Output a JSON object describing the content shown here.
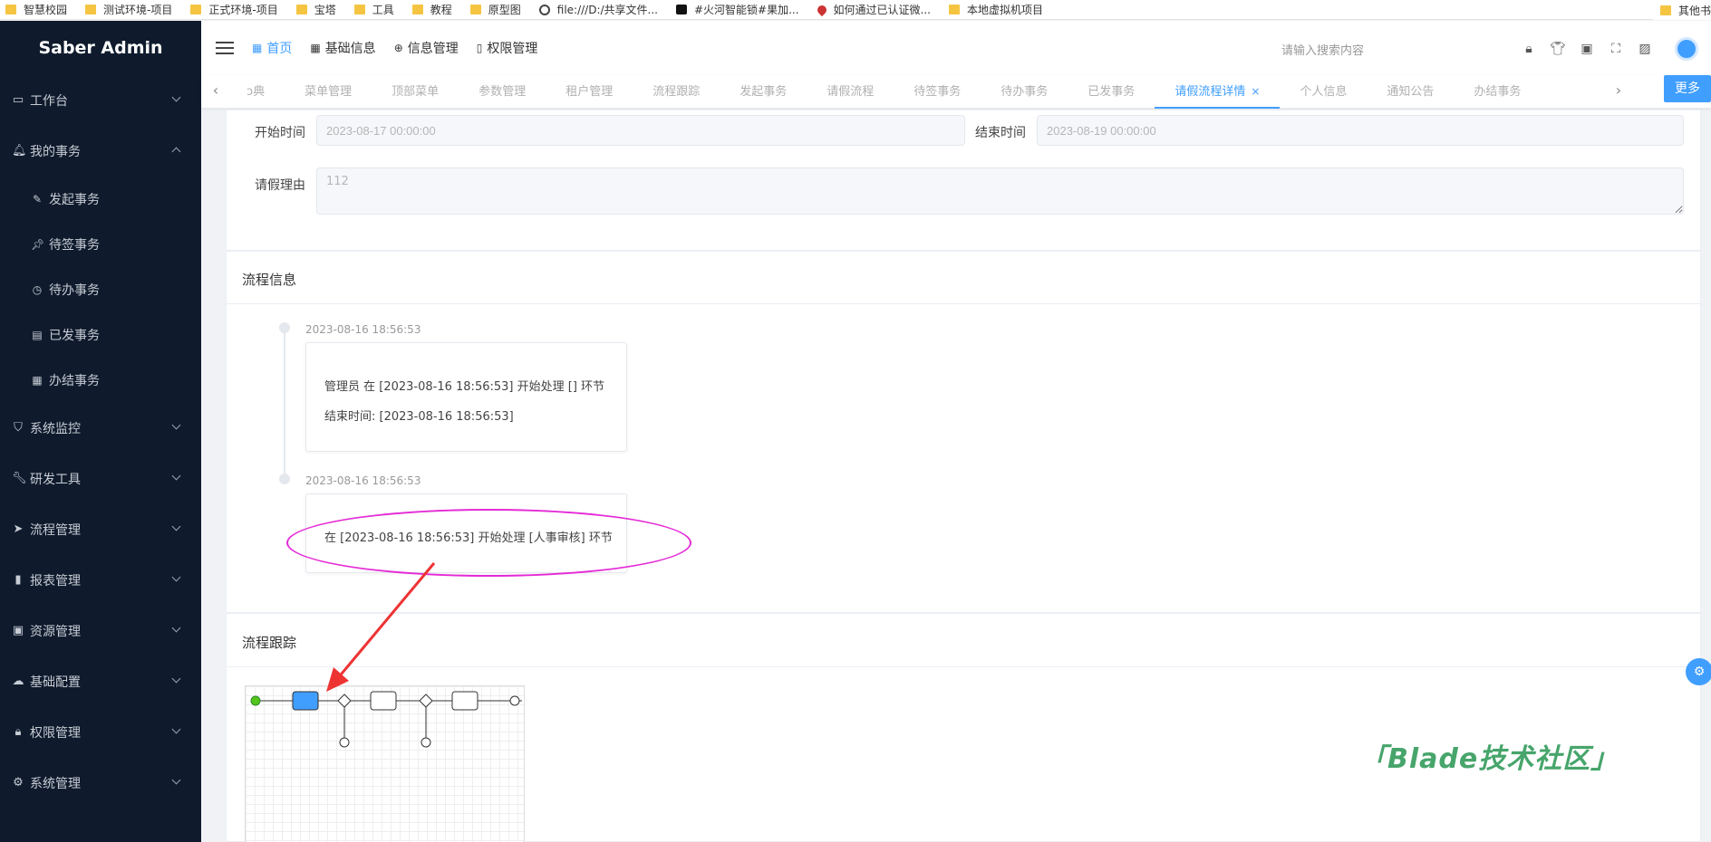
{
  "bookmarks": [
    "智慧校园",
    "测试环境-项目",
    "正式环境-项目",
    "宝塔",
    "工具",
    "教程",
    "原型图",
    "file:///D:/共享文件...",
    "#火河智能锁#果加...",
    "如何通过已认证微...",
    "本地虚拟机项目"
  ],
  "bookmark_icons": [
    "folder",
    "folder",
    "folder",
    "folder",
    "folder",
    "folder",
    "folder",
    "globe",
    "tiktok",
    "pin",
    "folder"
  ],
  "bookmarks_more": "其他书",
  "app": {
    "logo": "Saber Admin"
  },
  "sidebar": {
    "items": [
      {
        "label": "工作台",
        "icon": "monitor-icon"
      },
      {
        "label": "我的事务",
        "icon": "bell-icon",
        "expanded": true,
        "children": [
          {
            "label": "发起事务",
            "icon": "edit-icon"
          },
          {
            "label": "待签事务",
            "icon": "pin-icon"
          },
          {
            "label": "待办事务",
            "icon": "timer-icon"
          },
          {
            "label": "已发事务",
            "icon": "document-icon"
          },
          {
            "label": "办结事务",
            "icon": "document-check-icon"
          }
        ]
      },
      {
        "label": "系统监控",
        "icon": "shield-icon"
      },
      {
        "label": "研发工具",
        "icon": "wrench-icon"
      },
      {
        "label": "流程管理",
        "icon": "send-icon"
      },
      {
        "label": "报表管理",
        "icon": "bar-chart-icon"
      },
      {
        "label": "资源管理",
        "icon": "wallet-icon"
      },
      {
        "label": "基础配置",
        "icon": "cloud-icon"
      },
      {
        "label": "权限管理",
        "icon": "lock-icon"
      },
      {
        "label": "系统管理",
        "icon": "gear-icon"
      }
    ]
  },
  "topnav": {
    "items": [
      {
        "label": "首页",
        "icon": "grid-icon",
        "active": true
      },
      {
        "label": "基础信息",
        "icon": "apps-icon"
      },
      {
        "label": "信息管理",
        "icon": "plus-circle-icon"
      },
      {
        "label": "权限管理",
        "icon": "book-icon"
      }
    ],
    "search_placeholder": "请输入搜索内容"
  },
  "tabs": {
    "items": [
      "ɔ典",
      "菜单管理",
      "顶部菜单",
      "参数管理",
      "租户管理",
      "流程跟踪",
      "发起事务",
      "请假流程",
      "待签事务",
      "待办事务",
      "已发事务",
      "请假流程详情",
      "个人信息",
      "通知公告",
      "办结事务"
    ],
    "active_index": 11,
    "more_label": "更多"
  },
  "form": {
    "start_label": "开始时间",
    "start_value": "2023-08-17 00:00:00",
    "end_label": "结束时间",
    "end_value": "2023-08-19 00:00:00",
    "reason_label": "请假理由",
    "reason_value": "112"
  },
  "process_info": {
    "title": "流程信息",
    "entries": [
      {
        "time": "2023-08-16 18:56:53",
        "lines": [
          "管理员 在 [2023-08-16 18:56:53] 开始处理 [] 环节",
          "结束时间: [2023-08-16 18:56:53]"
        ]
      },
      {
        "time": "2023-08-16 18:56:53",
        "lines": [
          "在 [2023-08-16 18:56:53] 开始处理 [人事审核] 环节"
        ]
      }
    ]
  },
  "process_track": {
    "title": "流程跟踪"
  },
  "watermark": "「Blade技术社区」",
  "colors": {
    "accent": "#409eff",
    "sidebar": "#0f1b2d",
    "annotation": "#e42ad6",
    "arrow": "#ee3333"
  }
}
